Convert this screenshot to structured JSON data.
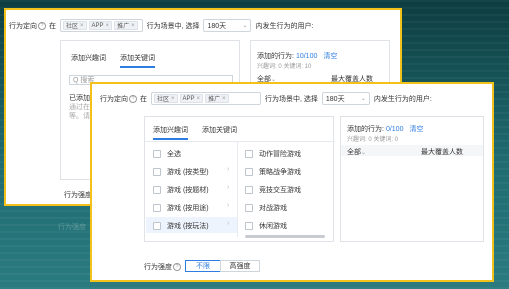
{
  "back_panel": {
    "row": {
      "label": "行为定向",
      "in": "在",
      "tags": [
        "社区",
        "APP",
        "推广"
      ],
      "scene_label": "行为场景中, 选择",
      "period": "180天",
      "suffix": "内发生行为的用户:"
    },
    "tabs": [
      "添加兴趣词",
      "添加关键词"
    ],
    "search_placeholder": "Q 搜索",
    "added_label": "已添加:",
    "hint_lines": [
      "通过在搜索",
      "等。请"
    ],
    "right": {
      "added_behaviors": "添加的行为:",
      "count": "10/100",
      "clear": "清空",
      "sub": "兴趣词: 0   关键词: 10",
      "col1": "全部",
      "col2": "最大覆盖人数"
    },
    "strength_label": "行为强度",
    "ghost_text": "行为强度"
  },
  "front_panel": {
    "row": {
      "label": "行为定向",
      "in": "在",
      "tags": [
        "社区",
        "APP",
        "推广"
      ],
      "scene_label": "行为场景中, 选择",
      "period": "180天",
      "suffix": "内发生行为的用户:"
    },
    "tabs": [
      "添加兴趣词",
      "添加关键词"
    ],
    "left_list": [
      "全选",
      "游戏 (按类型)",
      "游戏 (按题材)",
      "游戏 (按用途)",
      "游戏 (按玩法)"
    ],
    "right_list": [
      "动作冒险游戏",
      "策略战争游戏",
      "竞技交互游戏",
      "对战游戏",
      "休闲游戏"
    ],
    "right_panel": {
      "added_behaviors": "添加的行为:",
      "count": "0/100",
      "clear": "清空",
      "sub": "兴趣词: 0   关键词: 0",
      "col1": "全部",
      "col2": "最大覆盖人数"
    },
    "strength_label": "行为强度",
    "strength_options": [
      "不限",
      "高强度"
    ]
  }
}
